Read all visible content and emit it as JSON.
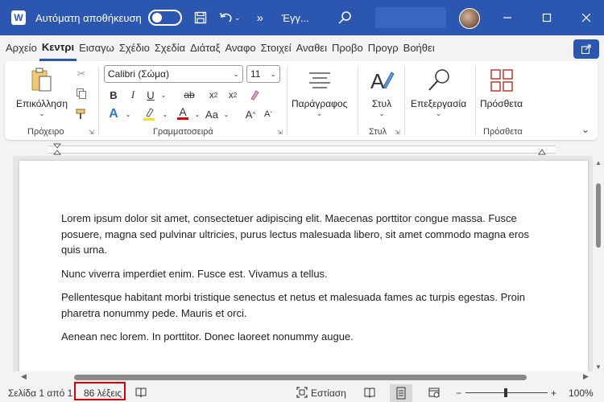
{
  "titlebar": {
    "app_icon": "W",
    "autosave_label": "Αυτόματη αποθήκευση",
    "doc_name": "Έγγ...",
    "more": "»"
  },
  "tabs": [
    "Αρχείο",
    "Κεντρι",
    "Εισαγω",
    "Σχέδιο",
    "Σχεδία",
    "Διάταξ",
    "Αναφο",
    "Στοιχεί",
    "Αναθει",
    "Προβο",
    "Προγρ",
    "Βοήθει"
  ],
  "ribbon": {
    "clipboard": {
      "paste_label": "Επικόλληση",
      "group_label": "Πρόχειρο"
    },
    "font": {
      "font_name": "Calibri (Σώμα)",
      "font_size": "11",
      "group_label": "Γραμματοσειρά"
    },
    "paragraph": {
      "label": "Παράγραφος"
    },
    "styles": {
      "label": "Στυλ",
      "group_label": "Στυλ"
    },
    "editing": {
      "label": "Επεξεργασία"
    },
    "addins": {
      "label": "Πρόσθετα",
      "group_label": "Πρόσθετα"
    }
  },
  "document": {
    "paragraphs": [
      "Lorem ipsum dolor sit amet, consectetuer adipiscing elit. Maecenas porttitor congue massa. Fusce posuere, magna sed pulvinar ultricies, purus lectus malesuada libero, sit amet commodo magna eros quis urna.",
      "Nunc viverra imperdiet enim. Fusce est. Vivamus a tellus.",
      "Pellentesque habitant morbi tristique senectus et netus et malesuada fames ac turpis egestas. Proin pharetra nonummy pede. Mauris et orci.",
      "Aenean nec lorem. In porttitor. Donec laoreet nonummy augue."
    ]
  },
  "statusbar": {
    "page": "Σελίδα 1 από 1",
    "words": "86 λέξεις",
    "focus": "Εστίαση",
    "zoom": "100%",
    "zoom_minus": "−",
    "zoom_plus": "+"
  },
  "colors": {
    "accent": "#2b57b1",
    "highlight_box": "#e00000"
  }
}
